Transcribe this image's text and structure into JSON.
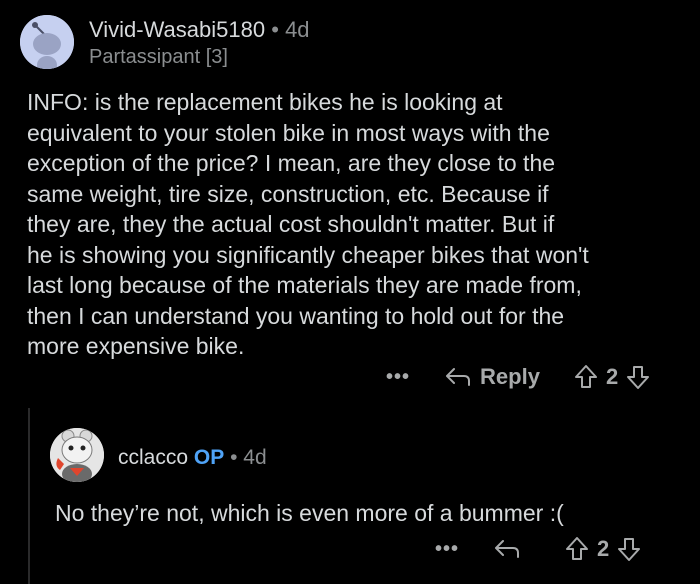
{
  "comment1": {
    "username": "Vivid-Wasabi5180",
    "separator": "•",
    "age": "4d",
    "flair": "Partassipant [3]",
    "body": "INFO:  is the replacement bikes he is looking at\nequivalent to your stolen bike in most ways with the\nexception of the price?  I mean, are they close to the\nsame weight, tire size, construction, etc.  Because if\nthey are, they the actual cost shouldn't matter.  But if\nhe is showing you significantly cheaper bikes that won't\nlast long because of the materials they are made from,\nthen I can understand you wanting to hold out for the\nmore expensive bike.",
    "more": "•••",
    "reply_label": "Reply",
    "votes": "2"
  },
  "comment2": {
    "username": "cclacco",
    "op_badge": "OP",
    "separator": "•",
    "age": "4d",
    "body": "No they’re not, which is even more of a bummer :(",
    "more": "•••",
    "votes": "2"
  }
}
